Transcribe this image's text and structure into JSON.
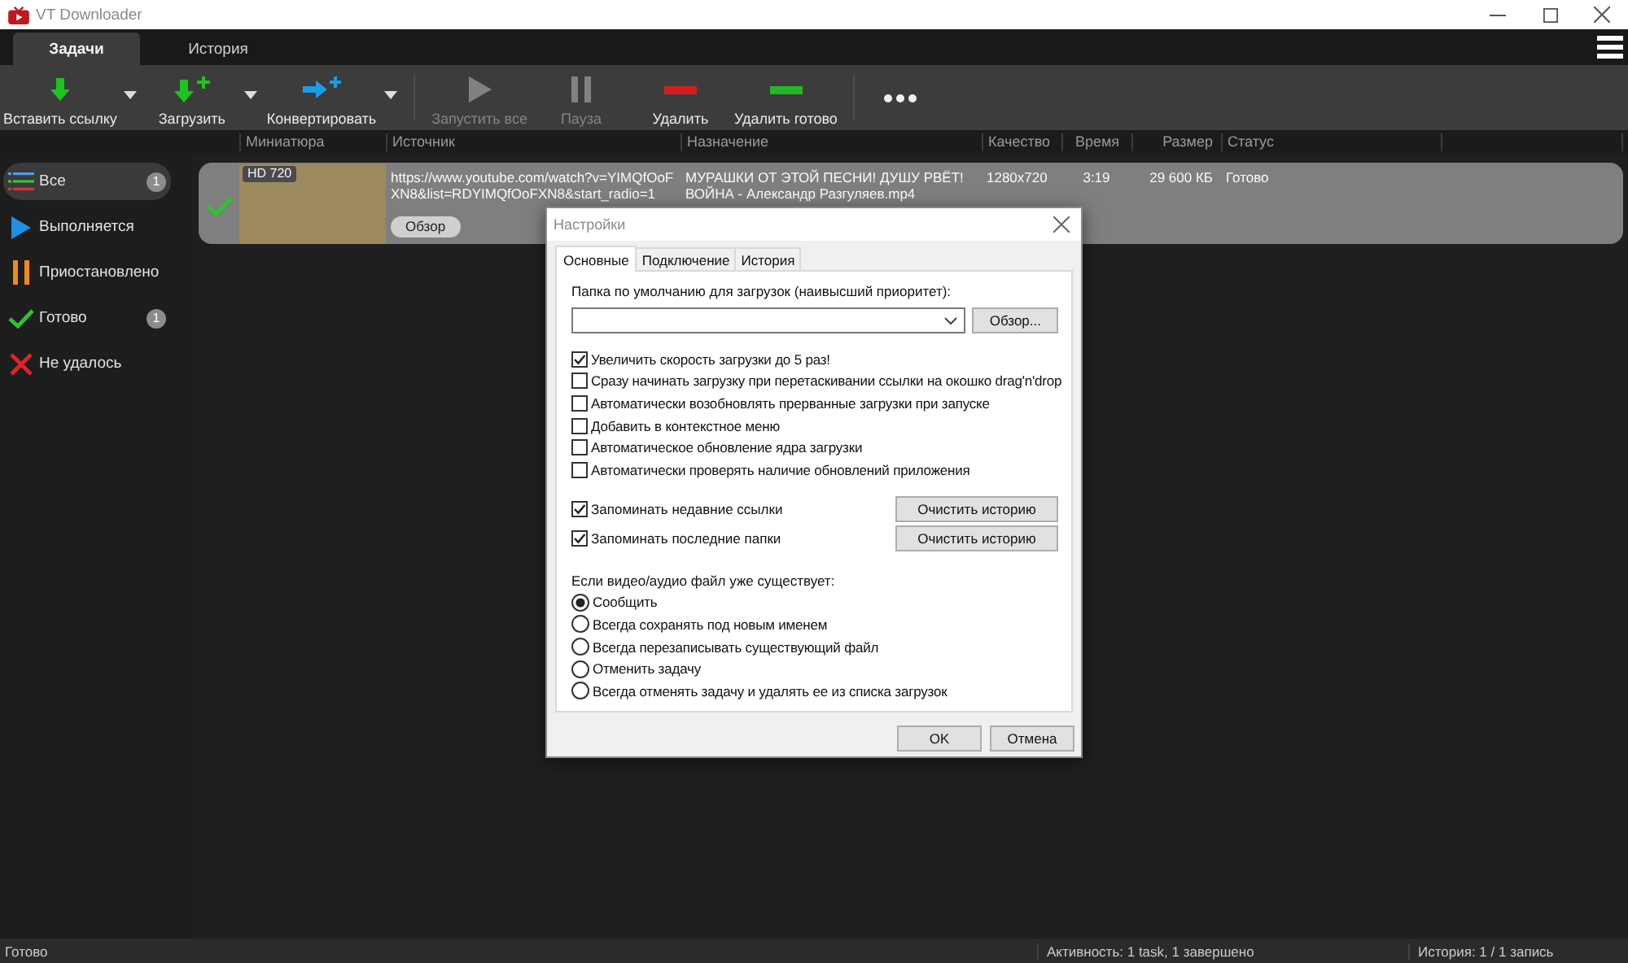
{
  "window": {
    "title": "VT Downloader"
  },
  "tabs": [
    {
      "label": "Задачи",
      "selected": true
    },
    {
      "label": "История",
      "selected": false
    }
  ],
  "toolbar": {
    "groups": [
      [
        {
          "kind": "paste",
          "label": "Вставить ссылку",
          "dropdown": true,
          "disabled": false
        },
        {
          "kind": "download",
          "label": "Загрузить",
          "dropdown": true,
          "disabled": false
        },
        {
          "kind": "convert",
          "label": "Конвертировать",
          "dropdown": true,
          "disabled": false
        }
      ],
      [
        {
          "kind": "start",
          "label": "Запустить все",
          "dropdown": false,
          "disabled": true
        },
        {
          "kind": "pause",
          "label": "Пауза",
          "dropdown": false,
          "disabled": true
        },
        {
          "kind": "delete",
          "label": "Удалить",
          "dropdown": false,
          "disabled": false
        },
        {
          "kind": "delete-done",
          "label": "Удалить готово",
          "dropdown": false,
          "disabled": false
        }
      ],
      [
        {
          "kind": "more",
          "dropdown": false,
          "disabled": false
        }
      ]
    ]
  },
  "columns": [
    "Миниатюра",
    "Источник",
    "Назначение",
    "Качество",
    "Время",
    "Размер",
    "Статус"
  ],
  "sidebar": {
    "items": [
      {
        "kind": "all",
        "label": "Все",
        "count": "1",
        "selected": true
      },
      {
        "kind": "running",
        "label": "Выполняется",
        "selected": false
      },
      {
        "kind": "paused",
        "label": "Приостановлено",
        "selected": false
      },
      {
        "kind": "done",
        "label": "Готово",
        "count": "1",
        "selected": false
      },
      {
        "kind": "failed",
        "label": "Не удалось",
        "selected": false
      }
    ]
  },
  "tasks": [
    {
      "kind": "done",
      "badge": "HD 720",
      "source": "https://www.youtube.com/watch?v=YIMQfOoFXN8&list=RDYIMQfOoFXN8&start_radio=1",
      "browse_button": "Обзор",
      "destination": "МУРАШКИ ОТ ЭТОЙ ПЕСНИ! ДУШУ РВЁТ! ВОЙНА - Александр Разгуляев.mp4",
      "quality": "1280x720",
      "duration": "3:19",
      "size": "29 600 КБ",
      "status": "Готово"
    }
  ],
  "dialog": {
    "title": "Настройки",
    "tabs": [
      {
        "label": "Основные",
        "selected": true
      },
      {
        "label": "Подключение",
        "selected": false
      },
      {
        "label": "История",
        "selected": false
      }
    ],
    "folder_label": "Папка по умолчанию для загрузок (наивысший приоритет):",
    "browse_button": "Обзор...",
    "options": [
      {
        "label": "Увеличить скорость загрузки до 5 раз!",
        "checked": true
      },
      {
        "label": "Сразу начинать загрузку при перетаскивании ссылки на окошко drag'n'drop",
        "checked": false
      },
      {
        "label": "Автоматически возобновлять прерванные загрузки при запуске",
        "checked": false
      },
      {
        "label": "Добавить в контекстное меню",
        "checked": false
      },
      {
        "label": "Автоматическое обновление ядра загрузки",
        "checked": false
      },
      {
        "label": "Автоматически проверять наличие обновлений приложения",
        "checked": false
      }
    ],
    "history_options": [
      {
        "label": "Запоминать недавние ссылки",
        "checked": true,
        "button": "Очистить историю"
      },
      {
        "label": "Запоминать последние папки",
        "checked": true,
        "button": "Очистить историю"
      }
    ],
    "exists_label": "Если видео/аудио файл уже существует:",
    "exists_options": [
      {
        "label": "Сообщить",
        "selected": true
      },
      {
        "label": "Всегда сохранять под новым именем",
        "selected": false
      },
      {
        "label": "Всегда перезаписывать существующий файл",
        "selected": false
      },
      {
        "label": "Отменить задачу",
        "selected": false
      },
      {
        "label": "Всегда отменять задачу и удалять ее из списка загрузок",
        "selected": false
      }
    ],
    "buttons": [
      "OK",
      "Отмена"
    ]
  },
  "status_bar": {
    "message": "Готово",
    "activity": "Активность: 1 task, 1 завершено",
    "history": "История: 1 / 1 запись"
  }
}
